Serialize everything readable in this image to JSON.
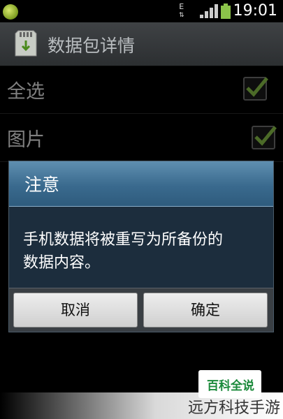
{
  "status_bar": {
    "network_type": "E",
    "time": "19:01"
  },
  "header": {
    "title": "数据包详情",
    "icon": "sd-card-icon"
  },
  "list": {
    "items": [
      {
        "label": "全选",
        "checked": true
      },
      {
        "label": "图片",
        "checked": true
      }
    ]
  },
  "dialog": {
    "title": "注意",
    "message_line1": "手机数据将被重写为所备份的",
    "message_line2": "数据内容。",
    "cancel_label": "取消",
    "ok_label": "确定"
  },
  "watermark": {
    "badge_text": "百科全说",
    "site_text": "远方科技手游"
  },
  "colors": {
    "checkmark": "#8bc34a",
    "dialog_header": "#3a6a8e"
  }
}
